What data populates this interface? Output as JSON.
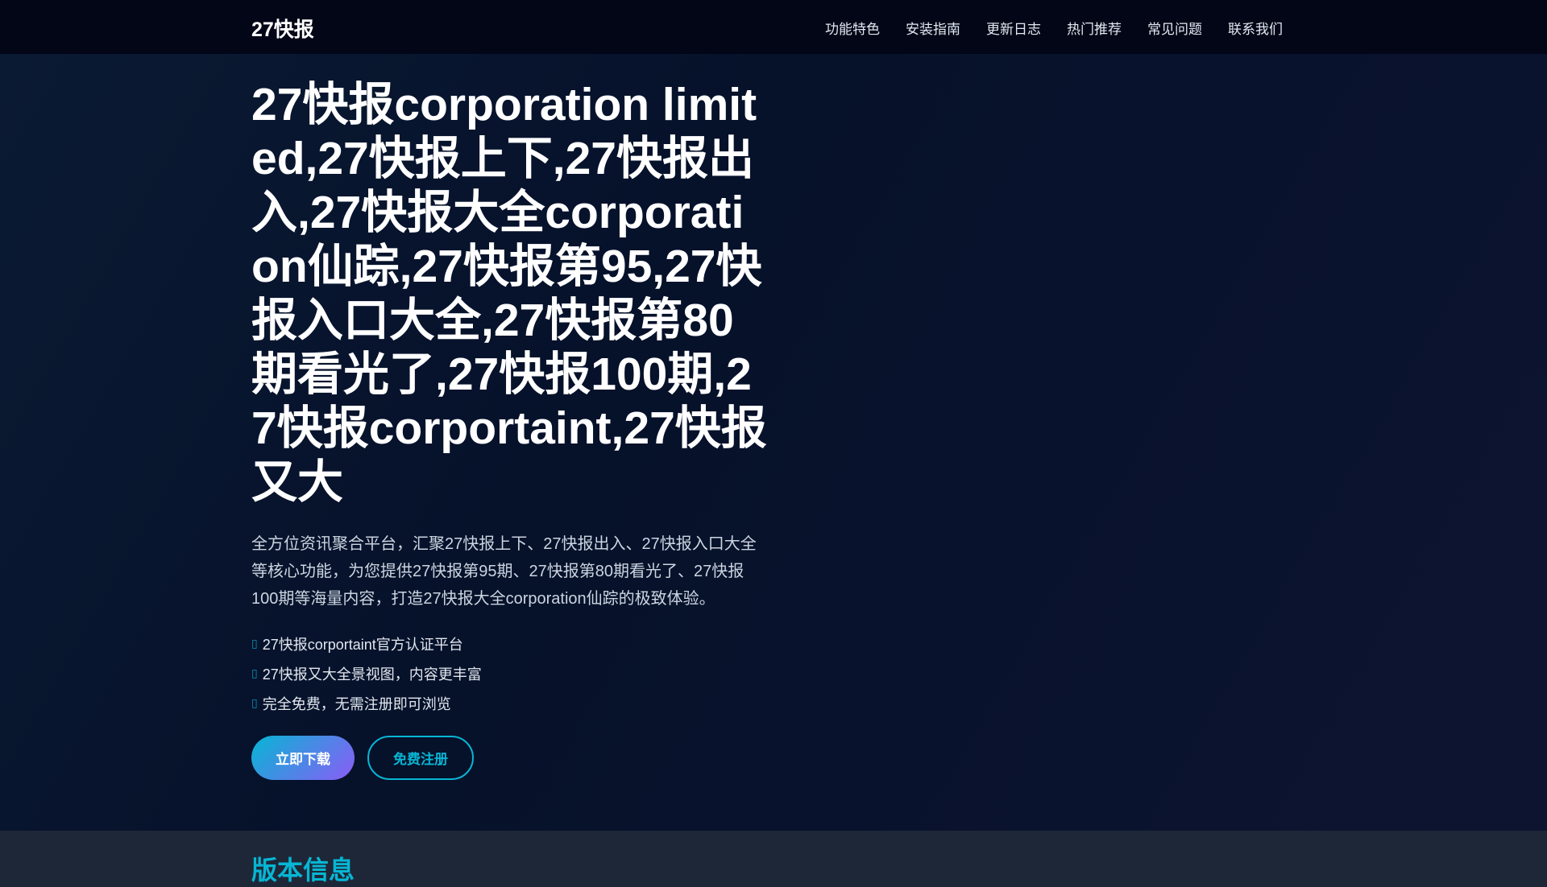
{
  "header": {
    "logo": "27快报",
    "nav": [
      "功能特色",
      "安装指南",
      "更新日志",
      "热门推荐",
      "常见问题",
      "联系我们"
    ]
  },
  "hero": {
    "title": "27快报corporation limited,27快报上下,27快报出入,27快报大全corporation仙踪,27快报第95,27快报入口大全,27快报第80期看光了,27快报100期,27快报corportaint,27快报又大",
    "description": "全方位资讯聚合平台，汇聚27快报上下、27快报出入、27快报入口大全等核心功能，为您提供27快报第95期、27快报第80期看光了、27快报100期等海量内容，打造27快报大全corporation仙踪的极致体验。",
    "features": [
      "27快报corportaint官方认证平台",
      "27快报又大全景视图，内容更丰富",
      "完全免费，无需注册即可浏览"
    ],
    "download_label": "立即下载",
    "register_label": "免费注册"
  },
  "section": {
    "title": "版本信息"
  }
}
